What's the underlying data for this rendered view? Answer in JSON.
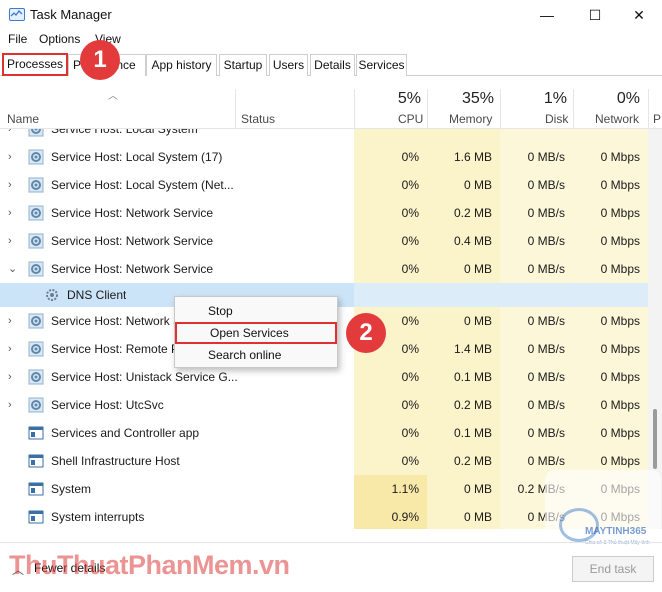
{
  "window": {
    "title": "Task Manager",
    "minimize": "—",
    "maximize": "☐",
    "close": "✕"
  },
  "menu": [
    "File",
    "Options",
    "View"
  ],
  "tabs": [
    "Processes",
    "Performance",
    "App history",
    "Startup",
    "Users",
    "Details",
    "Services"
  ],
  "tab_ghost": "Pe",
  "tab_perf_tail": "ance",
  "badges": [
    "1",
    "2"
  ],
  "header": {
    "name": "Name",
    "status": "Status",
    "cpu_pct": "5%",
    "cpu": "CPU",
    "mem_pct": "35%",
    "mem": "Memory",
    "disk_pct": "1%",
    "disk": "Disk",
    "net_pct": "0%",
    "net": "Network",
    "power": "P"
  },
  "rows": [
    {
      "name": "Service Host: Local System",
      "cpu": "",
      "mem": "",
      "disk": "",
      "net": "",
      "expand": true,
      "partial": true
    },
    {
      "name": "Service Host: Local System (17)",
      "cpu": "0%",
      "mem": "1.6 MB",
      "disk": "0 MB/s",
      "net": "0 Mbps",
      "expand": true
    },
    {
      "name": "Service Host: Local System (Net...",
      "cpu": "0%",
      "mem": "0 MB",
      "disk": "0 MB/s",
      "net": "0 Mbps",
      "expand": true
    },
    {
      "name": "Service Host: Network Service",
      "cpu": "0%",
      "mem": "0.2 MB",
      "disk": "0 MB/s",
      "net": "0 Mbps",
      "expand": true
    },
    {
      "name": "Service Host: Network Service",
      "cpu": "0%",
      "mem": "0.4 MB",
      "disk": "0 MB/s",
      "net": "0 Mbps",
      "expand": true
    },
    {
      "name": "Service Host: Network Service",
      "cpu": "0%",
      "mem": "0 MB",
      "disk": "0 MB/s",
      "net": "0 Mbps",
      "expand": true,
      "expanded": true
    },
    {
      "name": "DNS Client",
      "cpu": "",
      "mem": "",
      "disk": "",
      "net": "",
      "child": true,
      "selected": true
    },
    {
      "name": "Service Host: Network S",
      "cpu": "0%",
      "mem": "0 MB",
      "disk": "0 MB/s",
      "net": "0 Mbps",
      "expand": true
    },
    {
      "name": "Service Host: Remote P",
      "cpu": "0%",
      "mem": "1.4 MB",
      "disk": "0 MB/s",
      "net": "0 Mbps",
      "expand": true
    },
    {
      "name": "Service Host: Unistack Service G...",
      "cpu": "0%",
      "mem": "0.1 MB",
      "disk": "0 MB/s",
      "net": "0 Mbps",
      "expand": true
    },
    {
      "name": "Service Host: UtcSvc",
      "cpu": "0%",
      "mem": "0.2 MB",
      "disk": "0 MB/s",
      "net": "0 Mbps",
      "expand": true
    },
    {
      "name": "Services and Controller app",
      "cpu": "0%",
      "mem": "0.1 MB",
      "disk": "0 MB/s",
      "net": "0 Mbps",
      "expand": false
    },
    {
      "name": "Shell Infrastructure Host",
      "cpu": "0%",
      "mem": "0.2 MB",
      "disk": "0 MB/s",
      "net": "0 Mbps",
      "expand": false
    },
    {
      "name": "System",
      "cpu": "1.1%",
      "mem": "0 MB",
      "disk": "0.2 MB/s",
      "net": "0 Mbps",
      "expand": false,
      "hot": true
    },
    {
      "name": "System interrupts",
      "cpu": "0.9%",
      "mem": "0 MB",
      "disk": "0 MB/s",
      "net": "0 Mbps",
      "expand": false,
      "hot": true
    }
  ],
  "context_menu": [
    "Stop",
    "Open Services",
    "Search online"
  ],
  "footer": {
    "fewer": "Fewer details",
    "end_task": "End task"
  },
  "watermark": {
    "text": "ThuThuatPhanMem.vn",
    "brand": "MAYTINH365",
    "tagline": "Chia sẻ & Thủ thuật Máy tính"
  }
}
